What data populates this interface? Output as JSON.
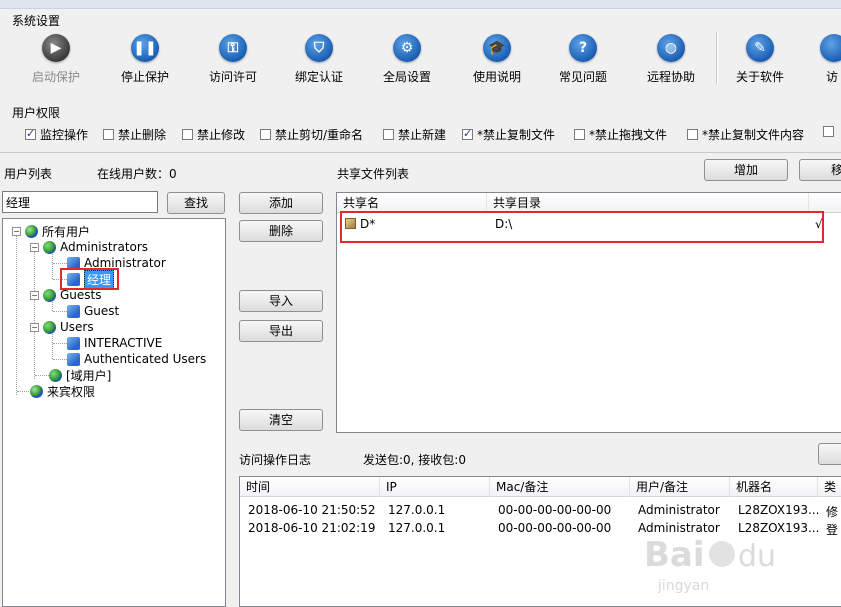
{
  "system_settings": {
    "label": "系统设置",
    "buttons": [
      {
        "label": "启动保护",
        "icon": "play-icon",
        "disabled": true
      },
      {
        "label": "停止保护",
        "icon": "pause-icon"
      },
      {
        "label": "访问许可",
        "icon": "key-icon"
      },
      {
        "label": "绑定认证",
        "icon": "shield-icon"
      },
      {
        "label": "全局设置",
        "icon": "gear-icon"
      },
      {
        "label": "使用说明",
        "icon": "graduation-cap-icon"
      },
      {
        "label": "常见问题",
        "icon": "question-icon"
      },
      {
        "label": "远程协助",
        "icon": "globe-icon"
      },
      {
        "label": "关于软件",
        "icon": "pen-icon"
      },
      {
        "label": "访",
        "icon": "partial-icon"
      }
    ]
  },
  "user_permissions": {
    "label": "用户权限",
    "items": [
      {
        "label": "监控操作",
        "checked": true
      },
      {
        "label": "禁止删除",
        "checked": false
      },
      {
        "label": "禁止修改",
        "checked": false
      },
      {
        "label": "禁止剪切/重命名",
        "checked": false
      },
      {
        "label": "禁止新建",
        "checked": false
      },
      {
        "label": "*禁止复制文件",
        "checked": true
      },
      {
        "label": "*禁止拖拽文件",
        "checked": false
      },
      {
        "label": "*禁止复制文件内容",
        "checked": false
      }
    ]
  },
  "user_list": {
    "label": "用户列表",
    "online_label": "在线用户数：0",
    "search_value": "经理",
    "search_button": "查找",
    "tree": {
      "root": "所有用户",
      "admins": "Administrators",
      "admin": "Administrator",
      "manager": "经理",
      "guests": "Guests",
      "guest": "Guest",
      "users": "Users",
      "interactive": "INTERACTIVE",
      "auth_users": "Authenticated Users",
      "domain_users": "[域用户]",
      "visitor": "来宾权限"
    }
  },
  "middle_buttons": {
    "add": "添加",
    "delete": "删除",
    "import": "导入",
    "export": "导出",
    "clear": "清空"
  },
  "share_list": {
    "label": "共享文件列表",
    "add_button": "增加",
    "remove_button_partial": "移",
    "columns": [
      "共享名",
      "共享目录"
    ],
    "rows": [
      {
        "name": "D*",
        "dir": "D:\\",
        "mark": "√"
      }
    ]
  },
  "log": {
    "label": "访问操作日志",
    "stats": "发送包:0, 接收包:0",
    "columns": [
      "时间",
      "IP",
      "Mac/备注",
      "用户/备注",
      "机器名",
      "类"
    ],
    "rows": [
      {
        "time": "2018-06-10 21:50:52",
        "ip": "127.0.0.1",
        "mac": "00-00-00-00-00-00",
        "user": "Administrator",
        "machine": "L28ZOX193...",
        "type": "修"
      },
      {
        "time": "2018-06-10 21:02:19",
        "ip": "127.0.0.1",
        "mac": "00-00-00-00-00-00",
        "user": "Administrator",
        "machine": "L28ZOX193...",
        "type": "登"
      }
    ]
  },
  "colors": {
    "accent": "#1a5fb4",
    "highlight": "#e0282e",
    "selection": "#3399ff"
  }
}
